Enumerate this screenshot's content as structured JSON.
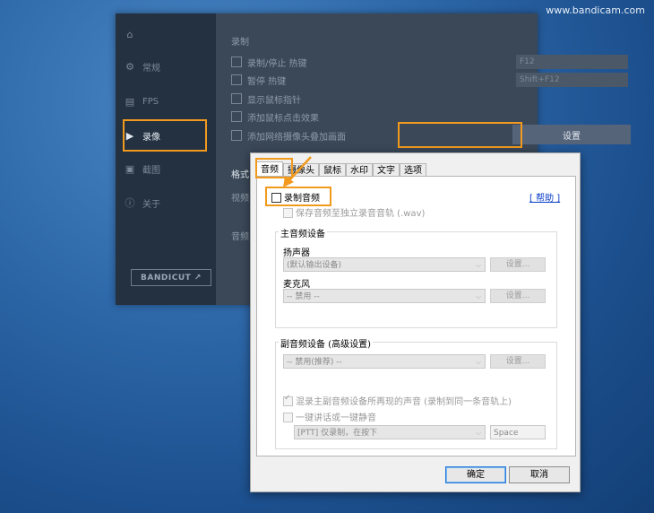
{
  "watermark": "www.bandicam.com",
  "main_window": {
    "sidebar": [
      {
        "label": "常规"
      },
      {
        "label": "FPS"
      },
      {
        "label": "录像"
      },
      {
        "label": "截图"
      },
      {
        "label": "关于"
      }
    ],
    "bandicut_label": "BANDICUT ↗",
    "section_label": "录制",
    "rows": [
      {
        "label": "录制/停止 热键",
        "value": "F12"
      },
      {
        "label": "暂停 热键",
        "value": "Shift+F12"
      },
      {
        "label": "显示鼠标指针"
      },
      {
        "label": "添加鼠标点击效果"
      },
      {
        "label": "添加网络摄像头叠加画面"
      }
    ],
    "settings_button": "设置",
    "format_label": "格式",
    "video_label": "视频",
    "audio_label": "音频"
  },
  "dialog": {
    "tabs": [
      "音频",
      "摄像头",
      "鼠标",
      "水印",
      "文字",
      "选项"
    ],
    "record_audio_label": "录制音频",
    "help_link": "[ 帮助 ]",
    "save_separate_label": "保存音频至独立录音音轨 (.wav)",
    "primary_group": {
      "title": "主音频设备",
      "speaker_label": "扬声器",
      "speaker_value": "(默认输出设备)",
      "mic_label": "麦克风",
      "mic_value": "-- 禁用 --",
      "settings_label": "设置..."
    },
    "secondary_group": {
      "title": "副音频设备 (高级设置)",
      "device_value": "-- 禁用(推荐) --",
      "settings_label": "设置...",
      "mix_label": "混录主副音频设备所再现的声音 (录制到同一条音轨上)",
      "ptt_label": "一键讲话或一键静音",
      "ptt_mode_value": "[PTT] 仅录制，在按下",
      "ptt_key_value": "Space"
    },
    "ok_label": "确定",
    "cancel_label": "取消"
  },
  "colors": {
    "highlight": "#f29a1e",
    "link": "#0a3cc8"
  }
}
